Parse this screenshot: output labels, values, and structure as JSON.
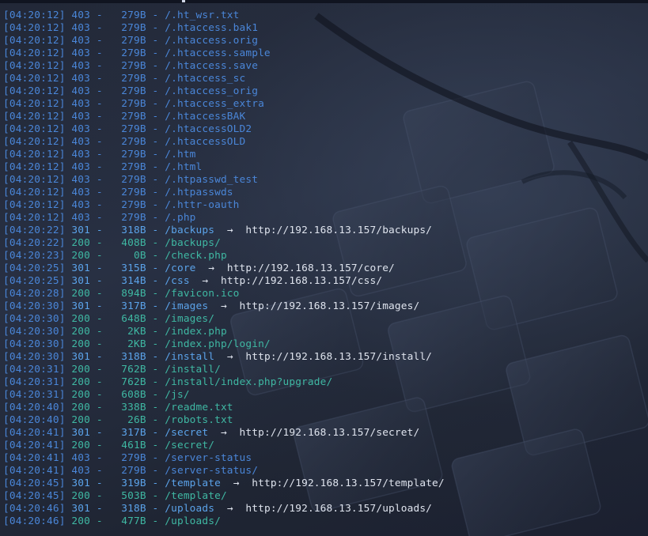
{
  "terminal": {
    "theme": {
      "background": "#222837",
      "color_403": "#4a86d8",
      "color_301": "#5ba3ea",
      "color_200": "#3fb8a3",
      "redirect_color": "#dfe4ee"
    },
    "arrow_symbol": "→",
    "entries": [
      {
        "time": "[04:20:12]",
        "status": "403",
        "size": "279B",
        "path": "/.ht_wsr.txt",
        "redirect": ""
      },
      {
        "time": "[04:20:12]",
        "status": "403",
        "size": "279B",
        "path": "/.htaccess.bak1",
        "redirect": ""
      },
      {
        "time": "[04:20:12]",
        "status": "403",
        "size": "279B",
        "path": "/.htaccess.orig",
        "redirect": ""
      },
      {
        "time": "[04:20:12]",
        "status": "403",
        "size": "279B",
        "path": "/.htaccess.sample",
        "redirect": ""
      },
      {
        "time": "[04:20:12]",
        "status": "403",
        "size": "279B",
        "path": "/.htaccess.save",
        "redirect": ""
      },
      {
        "time": "[04:20:12]",
        "status": "403",
        "size": "279B",
        "path": "/.htaccess_sc",
        "redirect": ""
      },
      {
        "time": "[04:20:12]",
        "status": "403",
        "size": "279B",
        "path": "/.htaccess_orig",
        "redirect": ""
      },
      {
        "time": "[04:20:12]",
        "status": "403",
        "size": "279B",
        "path": "/.htaccess_extra",
        "redirect": ""
      },
      {
        "time": "[04:20:12]",
        "status": "403",
        "size": "279B",
        "path": "/.htaccessBAK",
        "redirect": ""
      },
      {
        "time": "[04:20:12]",
        "status": "403",
        "size": "279B",
        "path": "/.htaccessOLD2",
        "redirect": ""
      },
      {
        "time": "[04:20:12]",
        "status": "403",
        "size": "279B",
        "path": "/.htaccessOLD",
        "redirect": ""
      },
      {
        "time": "[04:20:12]",
        "status": "403",
        "size": "279B",
        "path": "/.htm",
        "redirect": ""
      },
      {
        "time": "[04:20:12]",
        "status": "403",
        "size": "279B",
        "path": "/.html",
        "redirect": ""
      },
      {
        "time": "[04:20:12]",
        "status": "403",
        "size": "279B",
        "path": "/.htpasswd_test",
        "redirect": ""
      },
      {
        "time": "[04:20:12]",
        "status": "403",
        "size": "279B",
        "path": "/.htpasswds",
        "redirect": ""
      },
      {
        "time": "[04:20:12]",
        "status": "403",
        "size": "279B",
        "path": "/.httr-oauth",
        "redirect": ""
      },
      {
        "time": "[04:20:12]",
        "status": "403",
        "size": "279B",
        "path": "/.php",
        "redirect": ""
      },
      {
        "time": "[04:20:22]",
        "status": "301",
        "size": "318B",
        "path": "/backups",
        "redirect": "http://192.168.13.157/backups/"
      },
      {
        "time": "[04:20:22]",
        "status": "200",
        "size": "408B",
        "path": "/backups/",
        "redirect": ""
      },
      {
        "time": "[04:20:23]",
        "status": "200",
        "size": "0B",
        "path": "/check.php",
        "redirect": ""
      },
      {
        "time": "[04:20:25]",
        "status": "301",
        "size": "315B",
        "path": "/core",
        "redirect": "http://192.168.13.157/core/"
      },
      {
        "time": "[04:20:25]",
        "status": "301",
        "size": "314B",
        "path": "/css",
        "redirect": "http://192.168.13.157/css/"
      },
      {
        "time": "[04:20:28]",
        "status": "200",
        "size": "894B",
        "path": "/favicon.ico",
        "redirect": ""
      },
      {
        "time": "[04:20:30]",
        "status": "301",
        "size": "317B",
        "path": "/images",
        "redirect": "http://192.168.13.157/images/"
      },
      {
        "time": "[04:20:30]",
        "status": "200",
        "size": "648B",
        "path": "/images/",
        "redirect": ""
      },
      {
        "time": "[04:20:30]",
        "status": "200",
        "size": "2KB",
        "path": "/index.php",
        "redirect": ""
      },
      {
        "time": "[04:20:30]",
        "status": "200",
        "size": "2KB",
        "path": "/index.php/login/",
        "redirect": ""
      },
      {
        "time": "[04:20:30]",
        "status": "301",
        "size": "318B",
        "path": "/install",
        "redirect": "http://192.168.13.157/install/"
      },
      {
        "time": "[04:20:31]",
        "status": "200",
        "size": "762B",
        "path": "/install/",
        "redirect": ""
      },
      {
        "time": "[04:20:31]",
        "status": "200",
        "size": "762B",
        "path": "/install/index.php?upgrade/",
        "redirect": ""
      },
      {
        "time": "[04:20:31]",
        "status": "200",
        "size": "608B",
        "path": "/js/",
        "redirect": ""
      },
      {
        "time": "[04:20:40]",
        "status": "200",
        "size": "338B",
        "path": "/readme.txt",
        "redirect": ""
      },
      {
        "time": "[04:20:40]",
        "status": "200",
        "size": "26B",
        "path": "/robots.txt",
        "redirect": ""
      },
      {
        "time": "[04:20:41]",
        "status": "301",
        "size": "317B",
        "path": "/secret",
        "redirect": "http://192.168.13.157/secret/"
      },
      {
        "time": "[04:20:41]",
        "status": "200",
        "size": "461B",
        "path": "/secret/",
        "redirect": ""
      },
      {
        "time": "[04:20:41]",
        "status": "403",
        "size": "279B",
        "path": "/server-status",
        "redirect": ""
      },
      {
        "time": "[04:20:41]",
        "status": "403",
        "size": "279B",
        "path": "/server-status/",
        "redirect": ""
      },
      {
        "time": "[04:20:45]",
        "status": "301",
        "size": "319B",
        "path": "/template",
        "redirect": "http://192.168.13.157/template/"
      },
      {
        "time": "[04:20:45]",
        "status": "200",
        "size": "503B",
        "path": "/template/",
        "redirect": ""
      },
      {
        "time": "[04:20:46]",
        "status": "301",
        "size": "318B",
        "path": "/uploads",
        "redirect": "http://192.168.13.157/uploads/"
      },
      {
        "time": "[04:20:46]",
        "status": "200",
        "size": "477B",
        "path": "/uploads/",
        "redirect": ""
      }
    ]
  }
}
